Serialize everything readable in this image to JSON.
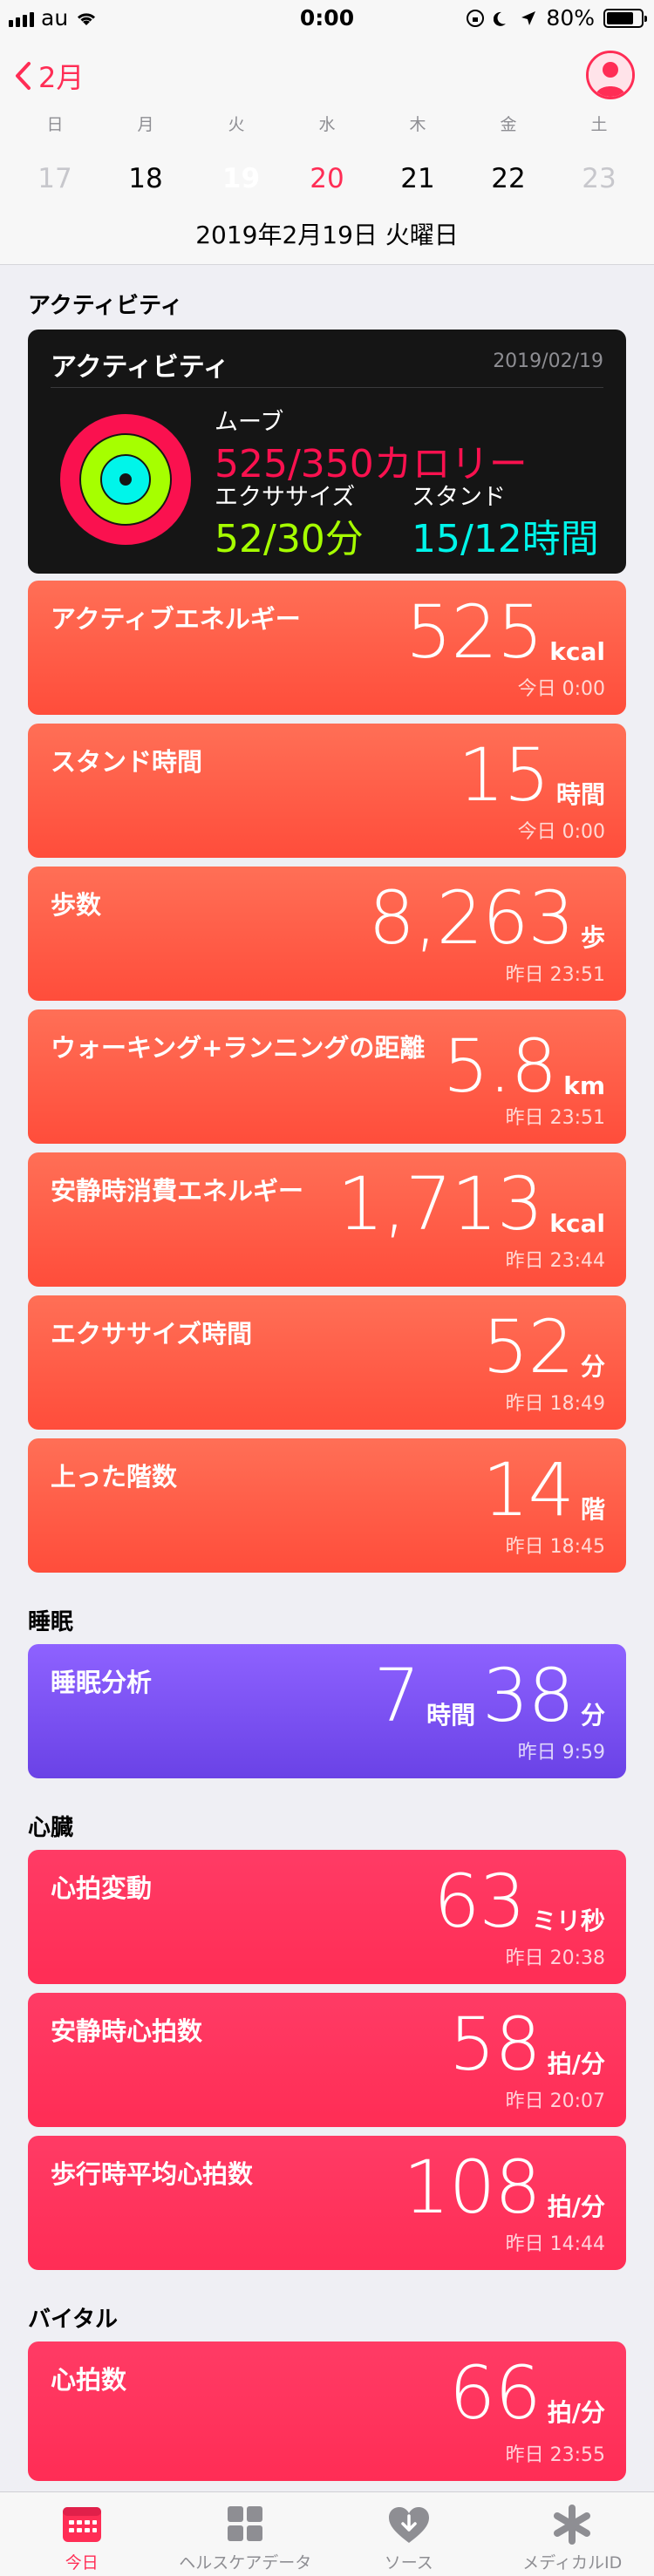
{
  "status_bar": {
    "carrier": "au",
    "time": "0:00",
    "battery": "80%",
    "battery_level": 0.8
  },
  "nav": {
    "back_label": "2月"
  },
  "calendar": {
    "weekdays": [
      "日",
      "月",
      "火",
      "水",
      "木",
      "金",
      "土"
    ],
    "dates": [
      "17",
      "18",
      "19",
      "20",
      "21",
      "22",
      "23"
    ],
    "selected_day_label": "2019年2月19日 火曜日"
  },
  "sections": {
    "activity": "アクティビティ",
    "sleep": "睡眠",
    "heart": "心臓",
    "vitals": "バイタル"
  },
  "activity_summary": {
    "title": "アクティビティ",
    "date": "2019/02/19",
    "move_label": "ムーブ",
    "move_value": "525/350カロリー",
    "exercise_label": "エクササイズ",
    "exercise_value": "52/30分",
    "stand_label": "スタンド",
    "stand_value": "15/12時間",
    "colors": {
      "move": "#fa114f",
      "exercise": "#a6ff00",
      "stand": "#00f5ea"
    }
  },
  "cards": [
    {
      "label": "アクティブエネルギー",
      "value": "525",
      "unit": "kcal",
      "time": "今日 0:00"
    },
    {
      "label": "スタンド時間",
      "value": "15",
      "unit": "時間",
      "time": "今日 0:00"
    },
    {
      "label": "歩数",
      "value": "8,263",
      "unit": "歩",
      "time": "昨日 23:51"
    },
    {
      "label": "ウォーキング+ランニングの距離",
      "value": "5.8",
      "unit": "km",
      "time": "昨日 23:51"
    },
    {
      "label": "安静時消費エネルギー",
      "value": "1,713",
      "unit": "kcal",
      "time": "昨日 23:44"
    },
    {
      "label": "エクササイズ時間",
      "value": "52",
      "unit": "分",
      "time": "昨日 18:49"
    },
    {
      "label": "上った階数",
      "value": "14",
      "unit": "階",
      "time": "昨日 18:45"
    },
    {
      "label": "睡眠分析",
      "value": "7",
      "unit": "時間",
      "value2": "38",
      "unit2": "分",
      "time": "昨日 9:59"
    },
    {
      "label": "心拍変動",
      "value": "63",
      "unit": "ミリ秒",
      "time": "昨日 20:38"
    },
    {
      "label": "安静時心拍数",
      "value": "58",
      "unit": "拍/分",
      "time": "昨日 20:07"
    },
    {
      "label": "歩行時平均心拍数",
      "value": "108",
      "unit": "拍/分",
      "time": "昨日 14:44"
    },
    {
      "label": "心拍数",
      "value": "66",
      "unit": "拍/分",
      "time": "昨日 23:55"
    }
  ],
  "tabbar": [
    {
      "label": "今日",
      "icon": "calendar-today-icon",
      "active": true
    },
    {
      "label": "ヘルスケアデータ",
      "icon": "grid-icon",
      "active": false
    },
    {
      "label": "ソース",
      "icon": "heart-download-icon",
      "active": false
    },
    {
      "label": "メディカルID",
      "icon": "asterisk-icon",
      "active": false
    }
  ],
  "accent_color": "#ff2d55"
}
